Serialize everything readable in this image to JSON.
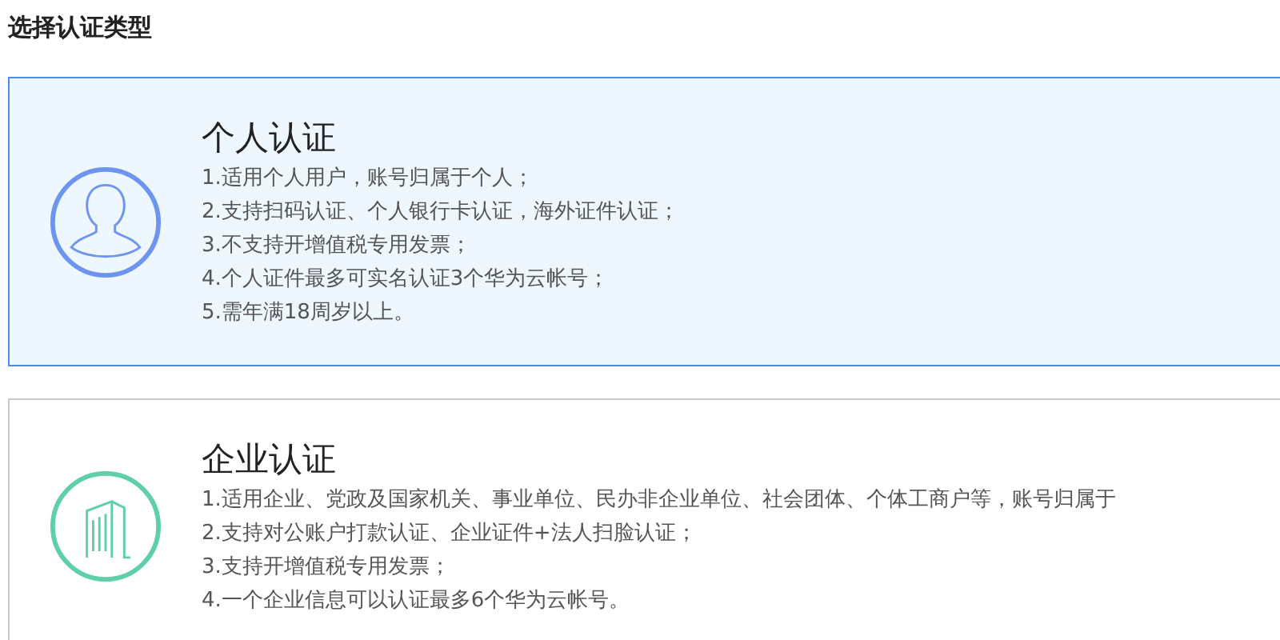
{
  "heading": "选择认证类型",
  "options": [
    {
      "kind": "person",
      "selected": true,
      "title": "个人认证",
      "lines": [
        "1.适用个人用户，账号归属于个人；",
        "2.支持扫码认证、个人银行卡认证，海外证件认证；",
        "3.不支持开增值税专用发票；",
        "4.个人证件最多可实名认证3个华为云帐号；",
        "5.需年满18周岁以上。"
      ]
    },
    {
      "kind": "building",
      "selected": false,
      "title": "企业认证",
      "lines": [
        "1.适用企业、党政及国家机关、事业单位、民办非企业单位、社会团体、个体工商户等，账号归属于",
        "2.支持对公账户打款认证、企业证件+法人扫脸认证；",
        "3.支持开增值税专用发票；",
        "4.一个企业信息可以认证最多6个华为云帐号。"
      ]
    }
  ]
}
